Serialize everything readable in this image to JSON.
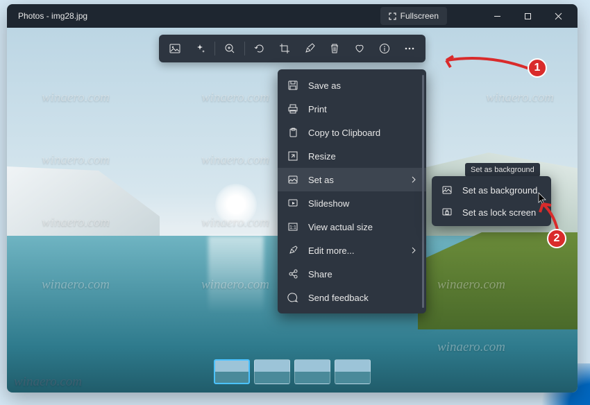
{
  "titlebar": {
    "app": "Photos",
    "filename": "img28.jpg",
    "fullscreen_label": "Fullscreen"
  },
  "toolbar": {
    "icons": [
      "image-icon",
      "sparkle-icon",
      "zoom-in-icon",
      "rotate-icon",
      "crop-icon",
      "markup-icon",
      "delete-icon",
      "favorite-icon",
      "info-icon",
      "more-icon"
    ]
  },
  "menu": {
    "items": [
      {
        "icon": "save-icon",
        "label": "Save as"
      },
      {
        "icon": "print-icon",
        "label": "Print"
      },
      {
        "icon": "clipboard-icon",
        "label": "Copy to Clipboard"
      },
      {
        "icon": "resize-icon",
        "label": "Resize"
      },
      {
        "icon": "setas-icon",
        "label": "Set as",
        "submenu": true,
        "hover": true
      },
      {
        "icon": "slideshow-icon",
        "label": "Slideshow"
      },
      {
        "icon": "actual-size-icon",
        "label": "View actual size"
      },
      {
        "icon": "edit-more-icon",
        "label": "Edit more...",
        "submenu": true
      },
      {
        "icon": "share-icon",
        "label": "Share"
      },
      {
        "icon": "feedback-icon",
        "label": "Send feedback"
      }
    ]
  },
  "submenu": {
    "tooltip": "Set as background",
    "items": [
      {
        "icon": "background-icon",
        "label": "Set as background"
      },
      {
        "icon": "lockscreen-icon",
        "label": "Set as lock screen"
      }
    ]
  },
  "badges": {
    "one": "1",
    "two": "2"
  },
  "watermark": "winaero.com",
  "thumbs": 4
}
